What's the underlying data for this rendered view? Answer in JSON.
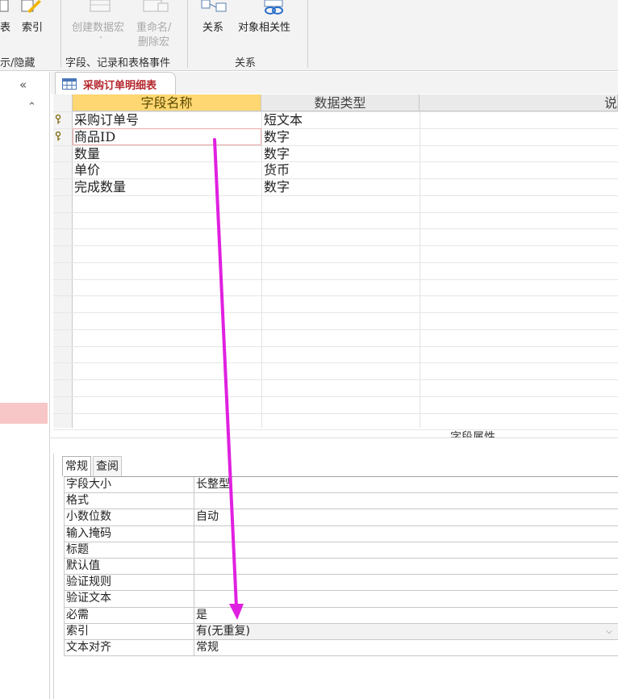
{
  "ribbon": {
    "buttons": {
      "table": "表",
      "index": "索引",
      "create_macro": "创建数据宏",
      "create_macro_sub": "·",
      "rename_macro_1": "重命名/",
      "rename_macro_2": "删除宏",
      "relationships": "关系",
      "object_dependencies": "对象相关性"
    },
    "groups": {
      "show_hide": "示/隐藏",
      "field_events": "字段、记录和表格事件",
      "relationships": "关系"
    }
  },
  "nav": {
    "collapse": "«",
    "expand_up": "⌃"
  },
  "document": {
    "tab_label": "采购订单明细表"
  },
  "design_grid": {
    "headers": {
      "field_name": "字段名称",
      "data_type": "数据类型",
      "description": "说"
    },
    "rows": [
      {
        "field_name": "采购订单号",
        "data_type": "短文本",
        "key": true
      },
      {
        "field_name": "商品ID",
        "data_type": "数字",
        "key": true
      },
      {
        "field_name": "数量",
        "data_type": "数字",
        "key": false
      },
      {
        "field_name": "单价",
        "data_type": "货币",
        "key": false
      },
      {
        "field_name": "完成数量",
        "data_type": "数字",
        "key": false
      }
    ]
  },
  "field_properties": {
    "title": "字段属性",
    "tabs": {
      "general": "常规",
      "lookup": "查阅"
    },
    "rows": [
      {
        "label": "字段大小",
        "value": "长整型"
      },
      {
        "label": "格式",
        "value": ""
      },
      {
        "label": "小数位数",
        "value": "自动"
      },
      {
        "label": "输入掩码",
        "value": ""
      },
      {
        "label": "标题",
        "value": ""
      },
      {
        "label": "默认值",
        "value": ""
      },
      {
        "label": "验证规则",
        "value": ""
      },
      {
        "label": "验证文本",
        "value": ""
      },
      {
        "label": "必需",
        "value": "是"
      },
      {
        "label": "索引",
        "value": "有(无重复)"
      },
      {
        "label": "文本对齐",
        "value": "常规"
      }
    ]
  },
  "colors": {
    "accent_header": "#ffd772",
    "tab_text": "#b4262d",
    "annotation_arrow": "#e020e0"
  }
}
